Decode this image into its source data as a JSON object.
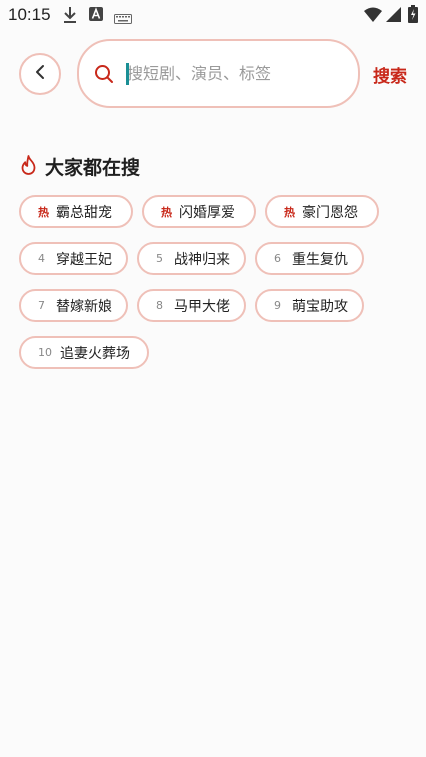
{
  "status_bar": {
    "time": "10:15",
    "left_icons": [
      "download-icon",
      "font-a-icon",
      "keyboard-icon"
    ],
    "right_icons": [
      "wifi-icon",
      "signal-icon",
      "battery-icon"
    ]
  },
  "search": {
    "placeholder": "搜短剧、演员、标签",
    "value": "",
    "action_label": "搜索"
  },
  "section": {
    "title": "大家都在搜",
    "icon": "flame-icon"
  },
  "tags": [
    {
      "rank": "热",
      "label": "霸总甜宠"
    },
    {
      "rank": "热",
      "label": "闪婚厚爱"
    },
    {
      "rank": "热",
      "label": "豪门恩怨"
    },
    {
      "rank": "4",
      "label": "穿越王妃"
    },
    {
      "rank": "5",
      "label": "战神归来"
    },
    {
      "rank": "6",
      "label": "重生复仇"
    },
    {
      "rank": "7",
      "label": "替嫁新娘"
    },
    {
      "rank": "8",
      "label": "马甲大佬"
    },
    {
      "rank": "9",
      "label": "萌宝助攻"
    },
    {
      "rank": "10",
      "label": "追妻火葬场"
    }
  ],
  "colors": {
    "accent": "#c8281a",
    "border": "#efc0b8",
    "background": "#fbfbfb"
  }
}
